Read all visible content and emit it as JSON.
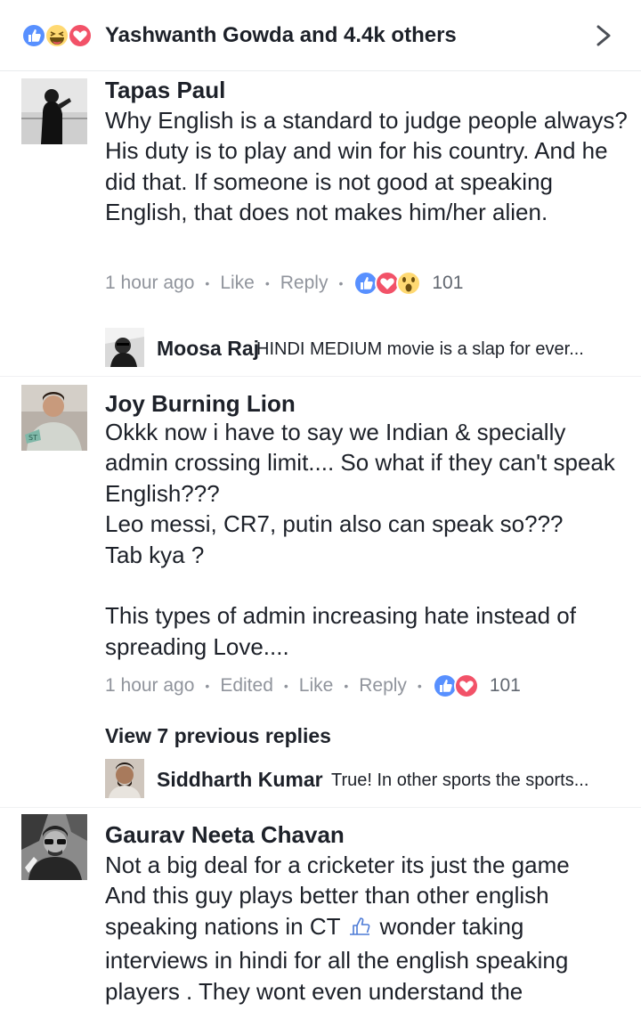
{
  "top_bar": {
    "reactors_text": "Yashwanth Gowda and 4.4k others",
    "reaction_icons": [
      "like-icon",
      "haha-icon",
      "love-icon"
    ],
    "chevron_icon": "chevron-right-icon"
  },
  "comments": [
    {
      "author": "Tapas Paul",
      "text": "Why English is a standard to judge people always? His duty is to play and win for his country. And he did that. If someone is not good at speaking English, that does not makes him/her alien.",
      "time": "1 hour ago",
      "like_label": "Like",
      "reply_label": "Reply",
      "reaction_icons": [
        "like-icon",
        "love-icon",
        "wow-icon"
      ],
      "reaction_count": "101",
      "reply_preview": {
        "author": "Moosa Raj",
        "text": "HINDI MEDIUM movie is a slap for ever..."
      }
    },
    {
      "author": "Joy Burning Lion",
      "text": "Okkk now i have to say we Indian & specially admin crossing limit.... So what if they can't speak English???\nLeo messi, CR7, putin also can speak so???\nTab kya ?\n\nThis types of admin increasing hate instead of spreading Love....",
      "time": "1 hour ago",
      "edited_label": "Edited",
      "like_label": "Like",
      "reply_label": "Reply",
      "reaction_icons": [
        "like-icon",
        "love-icon"
      ],
      "reaction_count": "101",
      "view_previous": "View 7 previous replies",
      "reply_preview": {
        "author": "Siddharth Kumar",
        "text": "True! In other sports the sports..."
      }
    },
    {
      "author": "Gaurav Neeta Chavan",
      "text_line1": "Not a big deal for a cricketer its just the game",
      "text_line2": "And this guy plays better than other english",
      "text_line3a": "speaking nations in CT",
      "text_line3b": "wonder taking",
      "text_line4": "interviews in hindi for all the english speaking",
      "text_line5": "players . They wont even understand the",
      "emoji_icon": "thumbs-up-outline-icon"
    }
  ],
  "colors": {
    "like_blue": "#5890ff",
    "love_red": "#f25268",
    "haha_yellow": "#ffd972",
    "text_dark": "#1d2129",
    "meta_gray": "#90949c"
  }
}
